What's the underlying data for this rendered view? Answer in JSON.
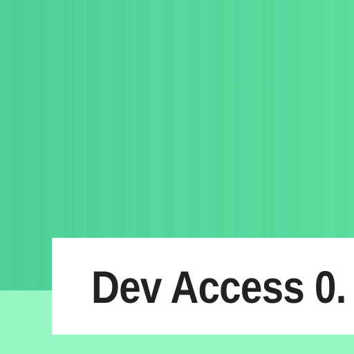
{
  "card": {
    "text": "Dev Access 0."
  },
  "colors": {
    "background": "#56d79b",
    "bottom_strip": "#96f6c4",
    "card_background": "#ffffff",
    "text": "#222222"
  }
}
